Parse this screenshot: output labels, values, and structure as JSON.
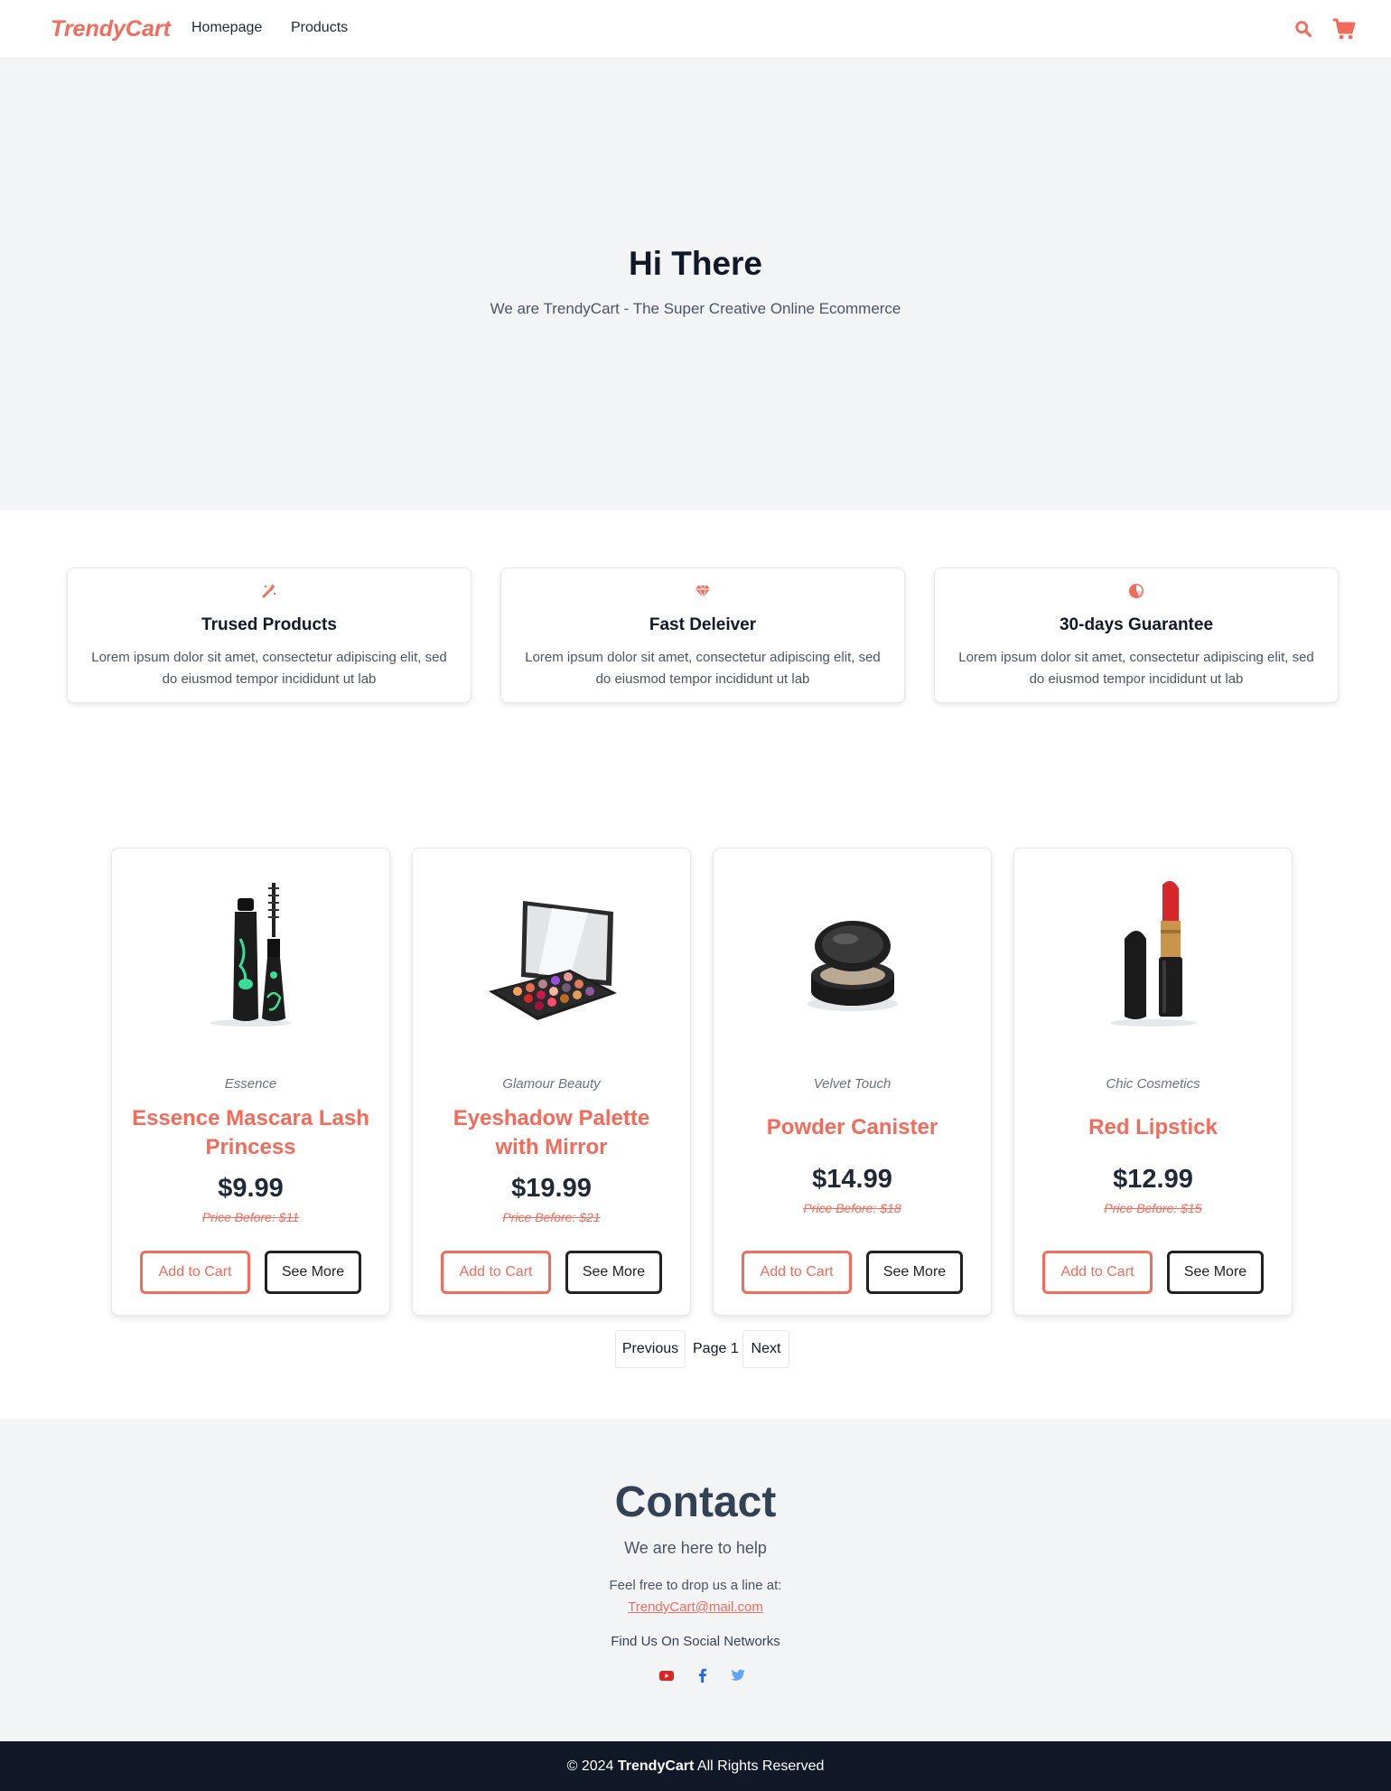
{
  "nav": {
    "logo": "TrendyCart",
    "links": [
      "Homepage",
      "Products"
    ],
    "icons": [
      "search-icon",
      "cart-icon"
    ],
    "accent_color": "#f26b5b"
  },
  "hero": {
    "title": "Hi There",
    "subtitle": "We are TrendyCart - The Super Creative Online Ecommerce"
  },
  "features": [
    {
      "icon": "magic-wand-icon",
      "title": "Trused Products",
      "text": "Lorem ipsum dolor sit amet, consectetur adipiscing elit, sed do eiusmod tempor incididunt ut lab"
    },
    {
      "icon": "gem-icon",
      "title": "Fast Deleiver",
      "text": "Lorem ipsum dolor sit amet, consectetur adipiscing elit, sed do eiusmod tempor incididunt ut lab"
    },
    {
      "icon": "chart-pie-icon",
      "title": "30-days Guarantee",
      "text": "Lorem ipsum dolor sit amet, consectetur adipiscing elit, sed do eiusmod tempor incididunt ut lab"
    }
  ],
  "products": [
    {
      "brand": "Essence",
      "name": "Essence Mascara Lash Princess",
      "price": "$9.99",
      "price_before": "Price Before: $11",
      "add_label": "Add to Cart",
      "more_label": "See More",
      "image": "mascara-image"
    },
    {
      "brand": "Glamour Beauty",
      "name": "Eyeshadow Palette with Mirror",
      "price": "$19.99",
      "price_before": "Price Before: $21",
      "add_label": "Add to Cart",
      "more_label": "See More",
      "image": "eyeshadow-palette-image"
    },
    {
      "brand": "Velvet Touch",
      "name": "Powder Canister",
      "price": "$14.99",
      "price_before": "Price Before: $18",
      "add_label": "Add to Cart",
      "more_label": "See More",
      "image": "powder-canister-image"
    },
    {
      "brand": "Chic Cosmetics",
      "name": "Red Lipstick",
      "price": "$12.99",
      "price_before": "Price Before: $15",
      "add_label": "Add to Cart",
      "more_label": "See More",
      "image": "red-lipstick-image"
    }
  ],
  "pagination": {
    "previous": "Previous",
    "page_label": "Page 1",
    "next": "Next"
  },
  "contact": {
    "title": "Contact",
    "subtitle": "We are here to help",
    "drop_line": "Feel free to drop us a line at:",
    "email": "TrendyCart@mail.com",
    "social_heading": "Find Us On Social Networks",
    "social_icons": [
      "youtube-icon",
      "facebook-icon",
      "twitter-icon"
    ]
  },
  "footer": {
    "prefix": "© 2024",
    "brand": "TrendyCart",
    "suffix": "All Rights Reserved"
  }
}
